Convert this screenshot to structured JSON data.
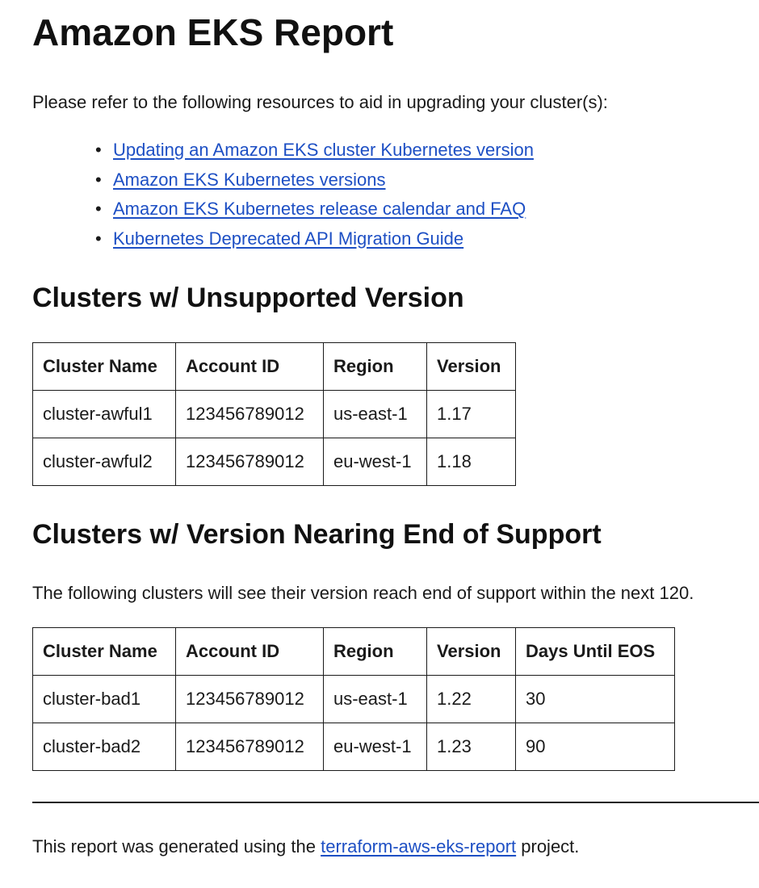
{
  "title": "Amazon EKS Report",
  "intro": "Please refer to the following resources to aid in upgrading your cluster(s):",
  "resources": [
    {
      "label": "Updating an Amazon EKS cluster Kubernetes version"
    },
    {
      "label": "Amazon EKS Kubernetes versions"
    },
    {
      "label": "Amazon EKS Kubernetes release calendar and FAQ"
    },
    {
      "label": "Kubernetes Deprecated API Migration Guide"
    }
  ],
  "unsupported": {
    "heading": "Clusters w/ Unsupported Version",
    "columns": [
      "Cluster Name",
      "Account ID",
      "Region",
      "Version"
    ],
    "rows": [
      [
        "cluster-awful1",
        "123456789012",
        "us-east-1",
        "1.17"
      ],
      [
        "cluster-awful2",
        "123456789012",
        "eu-west-1",
        "1.18"
      ]
    ]
  },
  "nearing": {
    "heading": "Clusters w/ Version Nearing End of Support",
    "description": "The following clusters will see their version reach end of support within the next 120.",
    "columns": [
      "Cluster Name",
      "Account ID",
      "Region",
      "Version",
      "Days Until EOS"
    ],
    "rows": [
      [
        "cluster-bad1",
        "123456789012",
        "us-east-1",
        "1.22",
        "30"
      ],
      [
        "cluster-bad2",
        "123456789012",
        "eu-west-1",
        "1.23",
        "90"
      ]
    ]
  },
  "footer": {
    "prefix": "This report was generated using the ",
    "link": "terraform-aws-eks-report",
    "suffix": " project."
  },
  "colors": {
    "link": "#1d4fc4",
    "text": "#1a1a1a"
  }
}
